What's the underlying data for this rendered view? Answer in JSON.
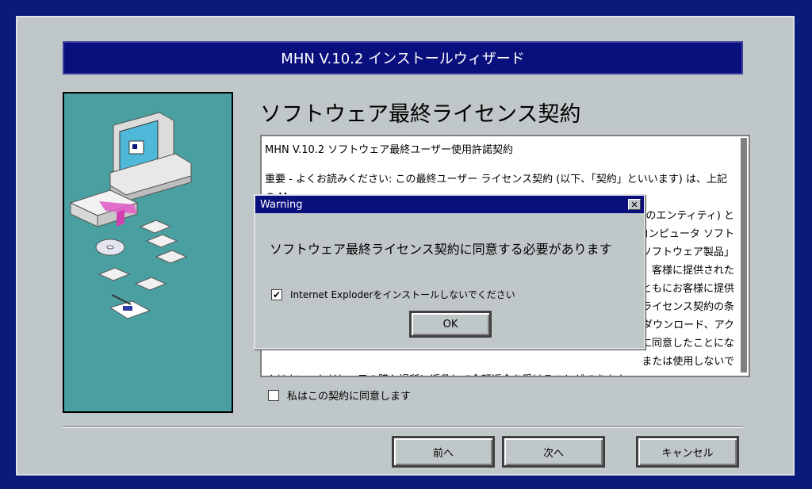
{
  "wizard": {
    "title": "MHN V.10.2 インストールウィザード",
    "heading": "ソフトウェア最終ライセンス契約",
    "license_lines": [
      "MHN V.10.2 ソフトウェア最終ユーザー使用許諾契約",
      "",
      "重要 - よくお読みください: この最終ユーザー ライセンス契約 (以下、「契約」といいます) は、上記の M",
      "ーのエンティティ) と",
      "、コンピュータ ソフト",
      "(「ソフトウェア製品」",
      "客様に提供された",
      "ともにお客様に提供",
      "ライセンス契約の条",
      "、ダウンロード、アク",
      "に同意したことにな",
      "または使用しないで",
      "ください。ただし、元の購入場所に返品して全額返金を受けることができます。"
    ],
    "agree_label": "私はこの契約に同意します",
    "agree_checked": false,
    "buttons": {
      "back": "前へ",
      "next": "次へ",
      "cancel": "キャンセル"
    }
  },
  "dialog": {
    "title": "Warning",
    "close_glyph": "✕",
    "message": "ソフトウェア最終ライセンス契約に同意する必要があります",
    "checkbox_label": "Internet Exploderをインストールしないでください",
    "checkbox_checked": true,
    "check_glyph": "✔",
    "ok": "OK"
  },
  "colors": {
    "background": "#0a1a7a",
    "window": "#c0c7c8",
    "titlebar": "#0a0f7e",
    "side_panel": "#4aa0a0"
  },
  "icons": [
    "computer-icon",
    "software-box-icon",
    "floppy-disk-icon",
    "cd-icon",
    "document-pen-icon"
  ]
}
